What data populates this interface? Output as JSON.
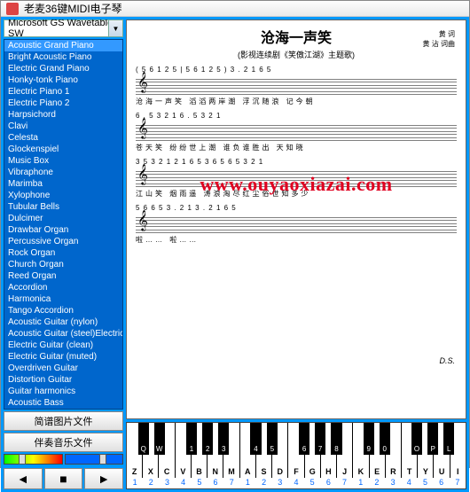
{
  "title": "老麦36键MIDI电子琴",
  "combo_value": "Microsoft GS Wavetable SW",
  "instruments": [
    "Acoustic Grand Piano",
    "Bright Acoustic Piano",
    "Electric Grand Piano",
    "Honky-tonk Piano",
    "Electric Piano 1",
    "Electric Piano 2",
    "Harpsichord",
    "Clavi",
    "Celesta",
    "Glockenspiel",
    "Music Box",
    "Vibraphone",
    "Marimba",
    "Xylophone",
    "Tubular Bells",
    "Dulcimer",
    "Drawbar Organ",
    "Percussive Organ",
    "Rock Organ",
    "Church Organ",
    "Reed Organ",
    "Accordion",
    "Harmonica",
    "Tango Accordion",
    "Acoustic Guitar (nylon)",
    "Acoustic Guitar (steel)Electric",
    "Electric Guitar (clean)",
    "Electric Guitar (muted)",
    "Overdriven Guitar",
    "Distortion Guitar",
    "Guitar harmonics",
    "Acoustic Bass"
  ],
  "btn_score": "简谱图片文件",
  "btn_accomp": "伴奏音乐文件",
  "ctrl": {
    "prev": "◄",
    "stop": "■",
    "next": "►"
  },
  "score": {
    "title": "沧海一声笑",
    "subtitle": "(影视连续剧《笑傲江湖》主题歌)",
    "credit1": "黄  词",
    "credit2": "黄 沾 词曲",
    "line1": "( 5 6 1 2 5 | 5 6 1 2 5 )                3 . 2 1   6 5",
    "lyric1": "沧海一声笑  滔滔两岸潮  浮沉随浪  记今朝",
    "line2": "6 . 5   3 2 1      6 . 5   3 2 1",
    "lyric2": "苍天笑  纷纷世上潮  谁负谁胜出  天知晓",
    "line3": "3 5 3 2 1   2 1 6 5 3   6 5 6 5 3 2 1",
    "lyric3": "江山笑  烟雨遥  涛浪淘尽红尘俗世知多少",
    "line4": "5 6 6 5 3 . 2 1   3 . 2 1   6 5",
    "lyric4": "啦……                啦……",
    "ds": "D.S."
  },
  "watermark": "www.ouyaoxiazai.com",
  "white_keys": [
    "Z",
    "X",
    "C",
    "V",
    "B",
    "N",
    "M",
    "A",
    "S",
    "D",
    "F",
    "G",
    "H",
    "J",
    "K",
    "E",
    "R",
    "T",
    "Y",
    "U",
    "I"
  ],
  "black_keys": [
    {
      "l": "Q",
      "p": 3.3
    },
    {
      "l": "W",
      "p": 8.0
    },
    {
      "l": "1",
      "p": 17.5
    },
    {
      "l": "2",
      "p": 22.3
    },
    {
      "l": "3",
      "p": 27.0
    },
    {
      "l": "4",
      "p": 36.5
    },
    {
      "l": "5",
      "p": 41.3
    },
    {
      "l": "6",
      "p": 50.8
    },
    {
      "l": "7",
      "p": 55.5
    },
    {
      "l": "8",
      "p": 60.3
    },
    {
      "l": "9",
      "p": 69.8
    },
    {
      "l": "0",
      "p": 74.5
    },
    {
      "l": "O",
      "p": 84.0
    },
    {
      "l": "P",
      "p": 88.8
    },
    {
      "l": "L",
      "p": 93.5
    }
  ],
  "octaves": [
    "1",
    "2",
    "3",
    "4",
    "5",
    "6",
    "7",
    "1",
    "2",
    "3",
    "4",
    "5",
    "6",
    "7",
    "1",
    "2",
    "3",
    "4",
    "5",
    "6",
    "7"
  ]
}
